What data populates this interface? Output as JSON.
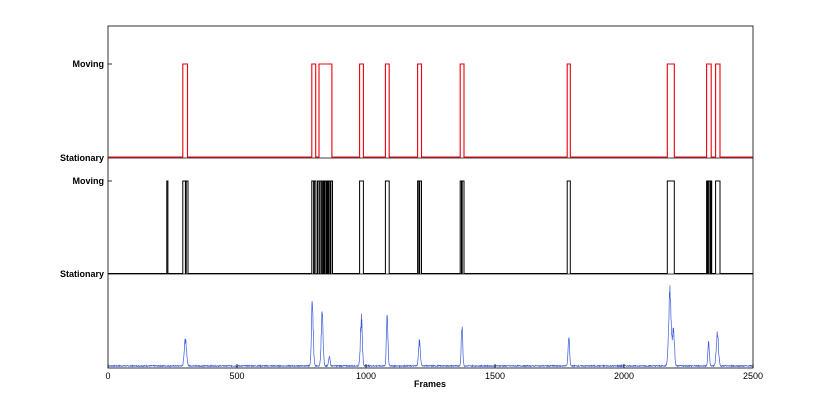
{
  "chart_data": {
    "type": "line",
    "xlabel": "Frames",
    "xlim": [
      0,
      2500
    ],
    "xticks": [
      0,
      500,
      1000,
      1500,
      2000,
      2500
    ],
    "xtick_labels": [
      "0",
      "500",
      "1000",
      "1500",
      "2000",
      "2500"
    ],
    "grid": false,
    "panels": [
      {
        "id": "top",
        "state_labels": [
          "Moving",
          "Stationary"
        ],
        "color": "#e8000b",
        "moving_intervals": [
          [
            290,
            308
          ],
          [
            790,
            805
          ],
          [
            818,
            868
          ],
          [
            975,
            990
          ],
          [
            1075,
            1090
          ],
          [
            1200,
            1215
          ],
          [
            1365,
            1380
          ],
          [
            1780,
            1792
          ],
          [
            2168,
            2195
          ],
          [
            2320,
            2338
          ],
          [
            2355,
            2372
          ]
        ]
      },
      {
        "id": "middle",
        "state_labels": [
          "Moving",
          "Stationary"
        ],
        "color": "#000000",
        "moving_intervals": [
          [
            228,
            232
          ],
          [
            290,
            300
          ],
          [
            303,
            310
          ],
          [
            790,
            797
          ],
          [
            800,
            806
          ],
          [
            812,
            818
          ],
          [
            822,
            828
          ],
          [
            832,
            836
          ],
          [
            840,
            845
          ],
          [
            848,
            852
          ],
          [
            855,
            860
          ],
          [
            864,
            870
          ],
          [
            975,
            990
          ],
          [
            1075,
            1090
          ],
          [
            1200,
            1205
          ],
          [
            1208,
            1215
          ],
          [
            1365,
            1370
          ],
          [
            1373,
            1380
          ],
          [
            1780,
            1792
          ],
          [
            2168,
            2195
          ],
          [
            2320,
            2324
          ],
          [
            2327,
            2333
          ],
          [
            2336,
            2340
          ],
          [
            2355,
            2372
          ]
        ]
      },
      {
        "id": "bottom",
        "color": "#3b5bdb",
        "ylim": [
          0,
          1
        ],
        "peaks": [
          {
            "x": 300,
            "h": 0.36,
            "w": 6
          },
          {
            "x": 792,
            "h": 0.78,
            "w": 5
          },
          {
            "x": 830,
            "h": 0.65,
            "w": 5
          },
          {
            "x": 858,
            "h": 0.12,
            "w": 4
          },
          {
            "x": 982,
            "h": 0.62,
            "w": 5
          },
          {
            "x": 1082,
            "h": 0.68,
            "w": 4
          },
          {
            "x": 1207,
            "h": 0.3,
            "w": 5
          },
          {
            "x": 1372,
            "h": 0.5,
            "w": 4
          },
          {
            "x": 1786,
            "h": 0.4,
            "w": 4
          },
          {
            "x": 2178,
            "h": 0.92,
            "w": 7
          },
          {
            "x": 2192,
            "h": 0.45,
            "w": 5
          },
          {
            "x": 2328,
            "h": 0.32,
            "w": 4
          },
          {
            "x": 2362,
            "h": 0.4,
            "w": 6
          }
        ]
      }
    ]
  }
}
